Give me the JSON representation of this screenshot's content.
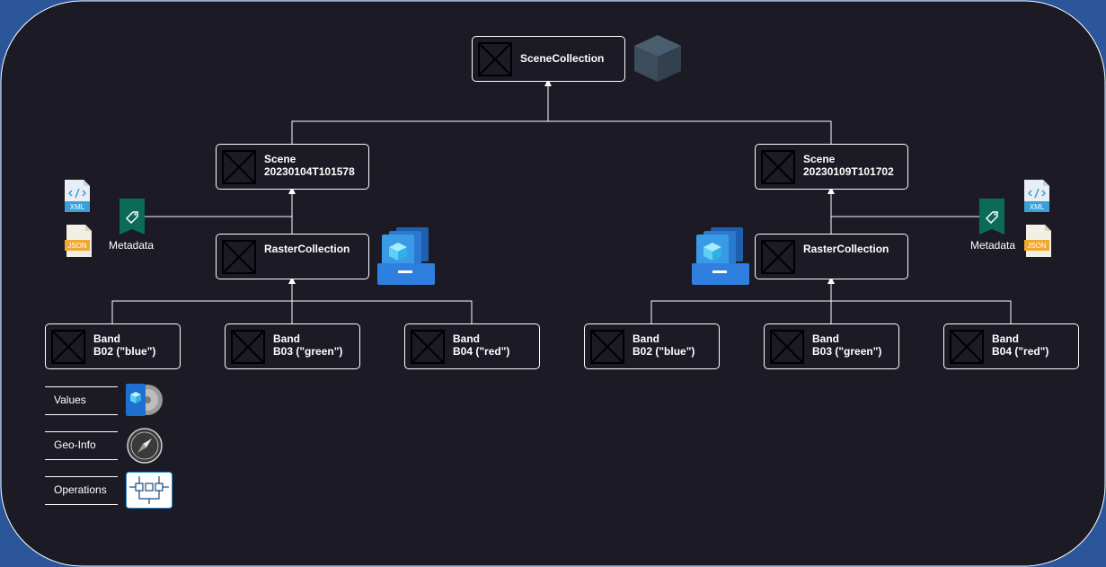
{
  "colors": {
    "frame_background": "#1b1a25",
    "outer_background": "#2b579a",
    "edge": "#ffffff",
    "node_border": "#ffffff"
  },
  "nodes": {
    "scene_collection": {
      "label": "SceneCollection"
    },
    "scene_left": {
      "line1": "Scene",
      "line2": "20230104T101578"
    },
    "scene_right": {
      "line1": "Scene",
      "line2": "20230109T101702"
    },
    "raster_left": {
      "label": "RasterCollection"
    },
    "raster_right": {
      "label": "RasterCollection"
    },
    "bands": [
      {
        "line1": "Band",
        "line2": "B02 (\"blue\")"
      },
      {
        "line1": "Band",
        "line2": "B03 (\"green\")"
      },
      {
        "line1": "Band",
        "line2": "B04 (\"red\")"
      },
      {
        "line1": "Band",
        "line2": "B02 (\"blue\")"
      },
      {
        "line1": "Band",
        "line2": "B03 (\"green\")"
      },
      {
        "line1": "Band",
        "line2": "B04 (\"red\")"
      }
    ]
  },
  "metadata": {
    "left_label": "Metadata",
    "right_label": "Metadata",
    "xml_text": "XML",
    "json_text": "JSON"
  },
  "legend": [
    {
      "label": "Values",
      "icon": "disk-icon"
    },
    {
      "label": "Geo-Info",
      "icon": "compass-icon"
    },
    {
      "label": "Operations",
      "icon": "operations-icon"
    }
  ],
  "icons": {
    "scene_collection": "cube-icon",
    "raster_collection": "stack-icon",
    "metadata": "tag-icon"
  }
}
